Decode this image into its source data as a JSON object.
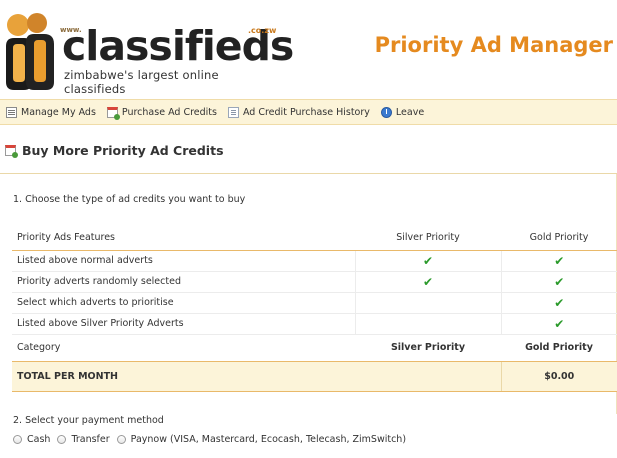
{
  "header": {
    "logo_www": "www.",
    "logo_word": "classifieds",
    "logo_domain": ".co.zw",
    "logo_tagline": "zimbabwe's largest online classifieds",
    "app_title": "Priority Ad Manager"
  },
  "nav": {
    "items": [
      {
        "label": "Manage My Ads",
        "icon": "list-icon"
      },
      {
        "label": "Purchase Ad Credits",
        "icon": "calendar-add-icon"
      },
      {
        "label": "Ad Credit Purchase History",
        "icon": "page-icon"
      },
      {
        "label": "Leave",
        "icon": "power-icon"
      }
    ]
  },
  "section": {
    "title": "Buy More Priority Ad Credits"
  },
  "step1": "1. Choose the type of ad credits you want to buy",
  "table": {
    "header": {
      "feature": "Priority Ads Features",
      "silver": "Silver Priority",
      "gold": "Gold Priority"
    },
    "rows": [
      {
        "feature": "Listed above normal adverts",
        "silver": "✔",
        "gold": "✔"
      },
      {
        "feature": "Priority adverts randomly selected",
        "silver": "✔",
        "gold": "✔"
      },
      {
        "feature": "Select which adverts to prioritise",
        "silver": "",
        "gold": "✔"
      },
      {
        "feature": "Listed above Silver Priority Adverts",
        "silver": "",
        "gold": "✔"
      }
    ],
    "category": {
      "label": "Category",
      "silver": "Silver Priority",
      "gold": "Gold Priority"
    },
    "total": {
      "label": "TOTAL PER MONTH",
      "silver": "",
      "gold": "$0.00"
    }
  },
  "step2": "2. Select your payment method",
  "payment": {
    "options": [
      "Cash",
      "Transfer",
      "Paynow (VISA, Mastercard, Ecocash, Telecash, ZimSwitch)"
    ]
  },
  "colors": {
    "accent": "#e58a1f",
    "nav_bg": "#fcf4d9",
    "check": "#2a9a2a"
  }
}
